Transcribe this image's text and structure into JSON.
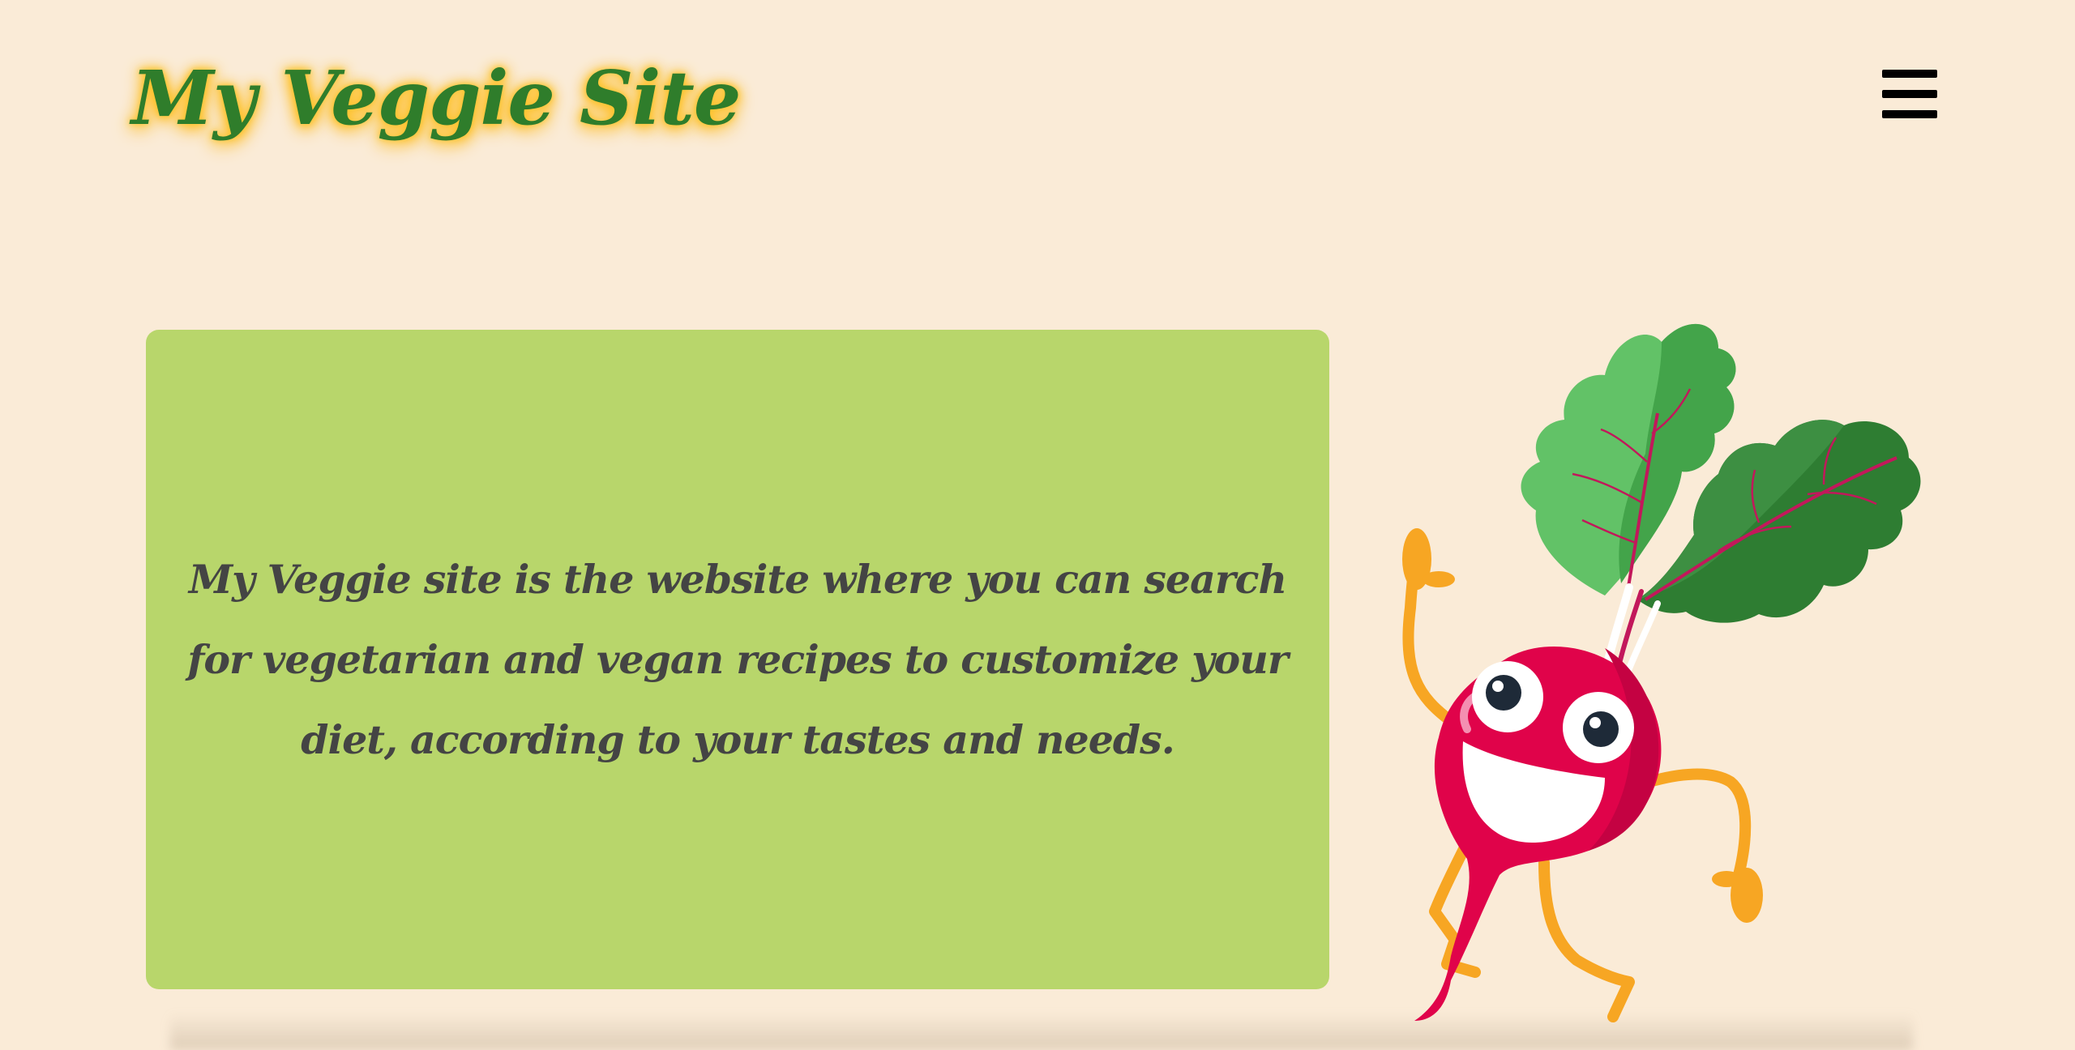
{
  "header": {
    "site_title": "My Veggie Site",
    "menu_icon": "hamburger-menu-icon"
  },
  "hero": {
    "description": "My Veggie site is the website where you can search for vegetarian and vegan recipes to customize your diet, according to your tastes and needs.",
    "mascot": "dancing-beet-mascot"
  },
  "colors": {
    "background": "#faebd7",
    "title_green": "#2f7d2b",
    "title_glow": "#ffc52e",
    "card_green": "#b8d66b",
    "text_dark": "#444444",
    "beet_red": "#e0034a",
    "limb_orange": "#f7a623",
    "leaf_green": "#3fa14a"
  }
}
